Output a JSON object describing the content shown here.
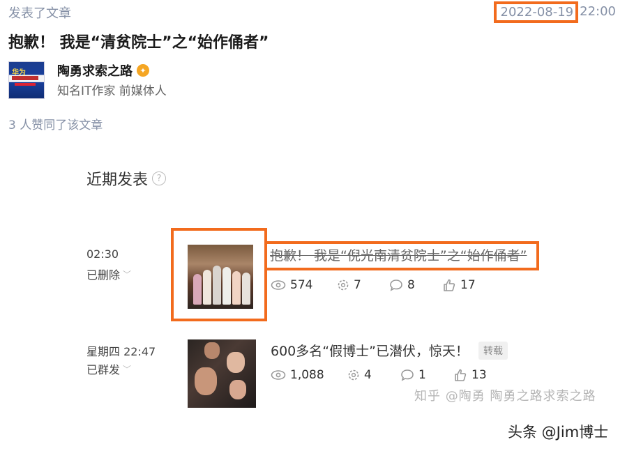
{
  "header": {
    "published_label": "发表了文章",
    "date": "2022-08-19",
    "time": "22:00"
  },
  "article": {
    "title": "抱歉！ 我是“清贫院士”之“始作俑者”"
  },
  "author": {
    "name": "陶勇求索之路",
    "description": "知名IT作家 前媒体人",
    "avatar_text": "华为"
  },
  "likes_text": "3 人赞同了该文章",
  "recent": {
    "title": "近期发表",
    "help_icon": "?",
    "posts": [
      {
        "time": "02:30",
        "status": "已删除",
        "title": "抱歉！ 我是“倪光南清贫院士”之“始作俑者”",
        "views": "574",
        "shares": "7",
        "comments": "8",
        "likes": "17"
      },
      {
        "time": "星期四 22:47",
        "status": "已群发",
        "title": "600多名“假博士”已潜伏，惊天！",
        "tag": "转载",
        "views": "1,088",
        "shares": "4",
        "comments": "1",
        "likes": "13"
      }
    ]
  },
  "watermarks": {
    "zhihu": "知乎 @陶勇 陶勇之路求索之路",
    "toutiao": "头条 @Jim博士"
  },
  "colors": {
    "highlight": "#f26b1d",
    "muted": "#8590a6"
  }
}
